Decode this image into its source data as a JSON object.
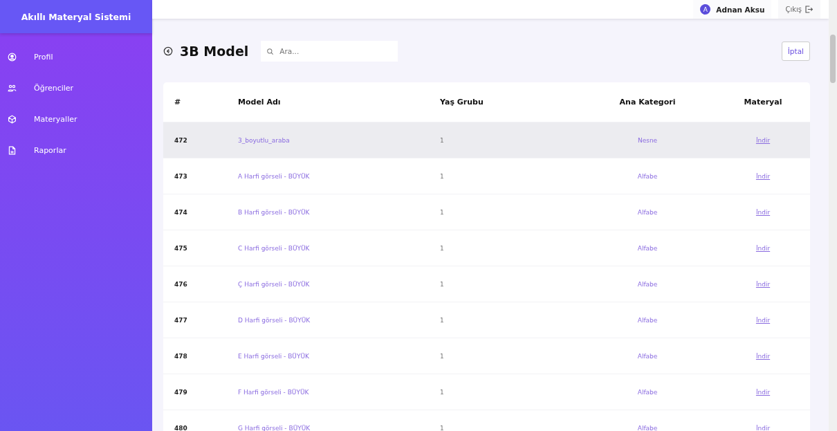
{
  "sidebar": {
    "title": "Akıllı Materyal Sistemi",
    "items": [
      {
        "label": "Profil"
      },
      {
        "label": "Öğrenciler"
      },
      {
        "label": "Materyaller"
      },
      {
        "label": "Raporlar"
      }
    ]
  },
  "topbar": {
    "user": {
      "initial": "A",
      "name": "Adnan Aksu"
    },
    "logout": "Çıkış"
  },
  "page": {
    "title": "3B Model",
    "search": {
      "placeholder": "Ara..."
    },
    "cancel": "İptal"
  },
  "table": {
    "columns": [
      "#",
      "Model Adı",
      "Yaş Grubu",
      "Ana Kategori",
      "Materyal"
    ],
    "rows": [
      {
        "id": "472",
        "name": "3_boyutlu_araba",
        "age": "1",
        "category": "Nesne",
        "link": "İndir",
        "selected": true
      },
      {
        "id": "473",
        "name": "A Harfi görseli - BÜYÜK",
        "age": "1",
        "category": "Alfabe",
        "link": "İndir",
        "selected": false
      },
      {
        "id": "474",
        "name": "B Harfi görseli - BÜYÜK",
        "age": "1",
        "category": "Alfabe",
        "link": "İndir",
        "selected": false
      },
      {
        "id": "475",
        "name": "C Harfi görseli - BÜYÜK",
        "age": "1",
        "category": "Alfabe",
        "link": "İndir",
        "selected": false
      },
      {
        "id": "476",
        "name": "Ç Harfi görseli - BÜYÜK",
        "age": "1",
        "category": "Alfabe",
        "link": "İndir",
        "selected": false
      },
      {
        "id": "477",
        "name": "D Harfi görseli - BÜYÜK",
        "age": "1",
        "category": "Alfabe",
        "link": "İndir",
        "selected": false
      },
      {
        "id": "478",
        "name": "E Harfi görseli - BÜYÜK",
        "age": "1",
        "category": "Alfabe",
        "link": "İndir",
        "selected": false
      },
      {
        "id": "479",
        "name": "F Harfi görseli - BÜYÜK",
        "age": "1",
        "category": "Alfabe",
        "link": "İndir",
        "selected": false
      },
      {
        "id": "480",
        "name": "G Harfi görseli - BÜYÜK",
        "age": "1",
        "category": "Alfabe",
        "link": "İndir",
        "selected": false
      }
    ]
  }
}
